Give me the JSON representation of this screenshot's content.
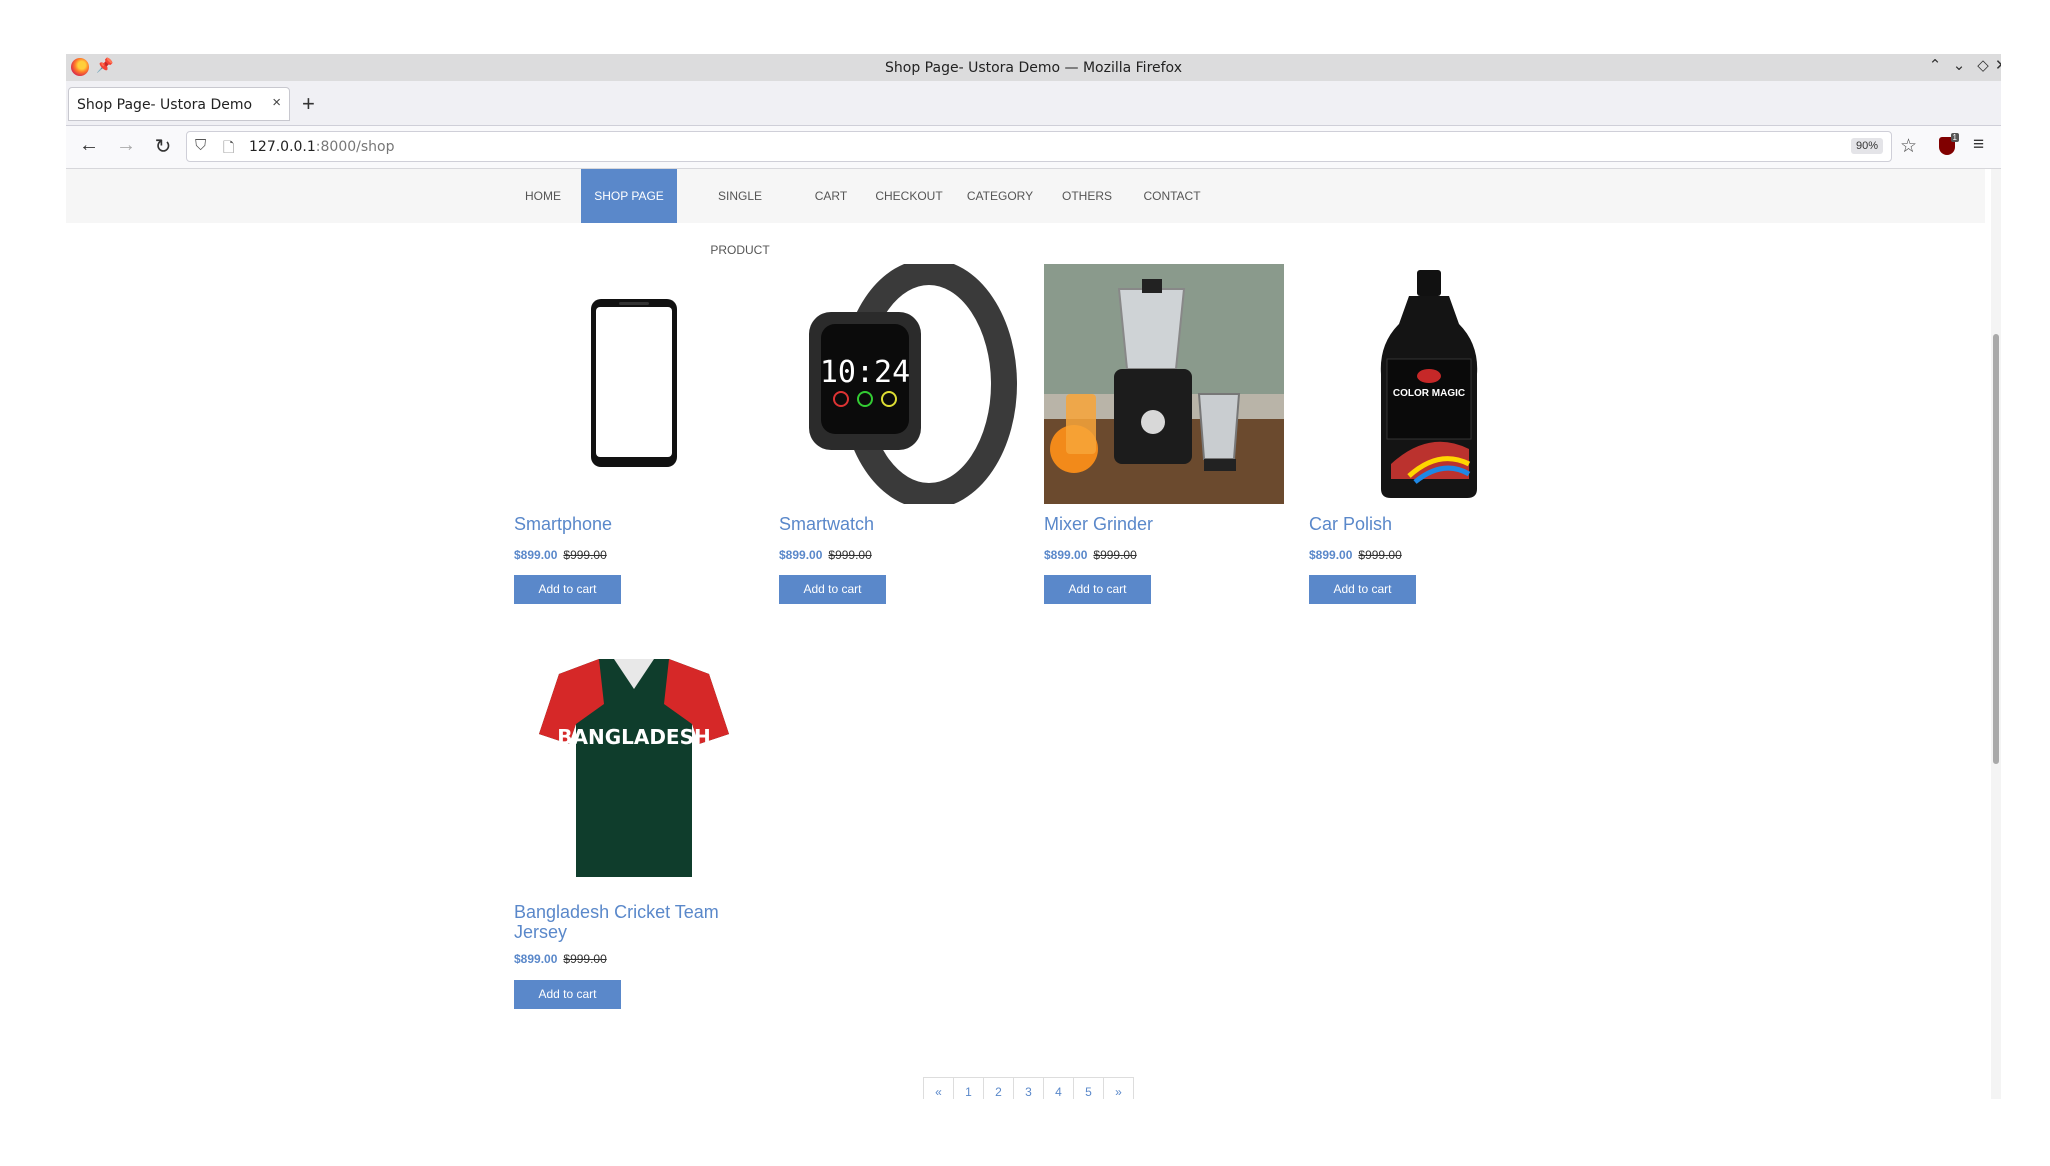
{
  "window": {
    "title": "Shop Page- Ustora Demo — Mozilla Firefox",
    "controls": [
      "⌃",
      "⌄",
      "◇",
      "✕"
    ]
  },
  "tabs": [
    {
      "title": "Shop Page- Ustora Demo",
      "close": "×"
    }
  ],
  "newtab": "+",
  "nav": {
    "back": "←",
    "forward": "→",
    "reload": "↻",
    "url_host": "127.0.0.1",
    "url_path": ":8000/shop",
    "zoom": "90%",
    "bookmark": "☆",
    "menu": "≡",
    "ublock_badge": "1"
  },
  "site_nav": [
    "HOME",
    "SHOP PAGE",
    "SINGLE PRODUCT",
    "CART",
    "CHECKOUT",
    "CATEGORY",
    "OTHERS",
    "CONTACT"
  ],
  "active_nav": "SHOP PAGE",
  "products": [
    {
      "name": "Smartphone",
      "price": "$899.00",
      "old_price": "$999.00",
      "button": "Add to cart",
      "icon": "smartphone-image"
    },
    {
      "name": "Smartwatch",
      "price": "$899.00",
      "old_price": "$999.00",
      "button": "Add to cart",
      "icon": "smartwatch-image",
      "watch_time": "10:24"
    },
    {
      "name": "Mixer Grinder",
      "price": "$899.00",
      "old_price": "$999.00",
      "button": "Add to cart",
      "icon": "mixer-grinder-image"
    },
    {
      "name": "Car Polish",
      "price": "$899.00",
      "old_price": "$999.00",
      "button": "Add to cart",
      "icon": "car-polish-image",
      "label_text": "COLOR MAGIC"
    },
    {
      "name": "Bangladesh Cricket Team Jersey",
      "price": "$899.00",
      "old_price": "$999.00",
      "button": "Add to cart",
      "icon": "jersey-image",
      "jersey_text": "BANGLADESH"
    }
  ],
  "pagination": [
    "«",
    "1",
    "2",
    "3",
    "4",
    "5",
    "»"
  ]
}
